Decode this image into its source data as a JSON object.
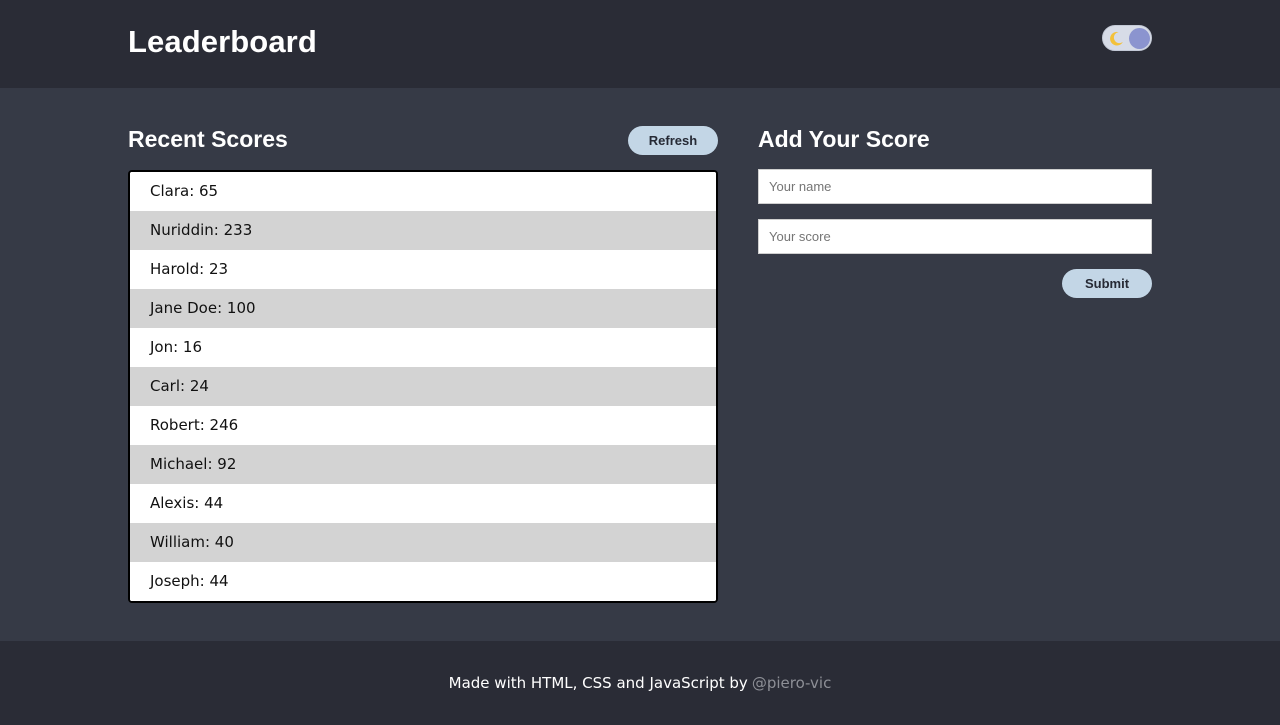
{
  "header": {
    "title": "Leaderboard",
    "theme_toggle": {
      "icon": "moon-icon",
      "state": "dark"
    }
  },
  "recent": {
    "title": "Recent Scores",
    "refresh_label": "Refresh",
    "scores": [
      "Clara: 65",
      "Nuriddin: 233",
      "Harold: 23",
      "Jane Doe: 100",
      "Jon: 16",
      "Carl: 24",
      "Robert: 246",
      "Michael: 92",
      "Alexis: 44",
      "William: 40",
      "Joseph: 44"
    ]
  },
  "add": {
    "title": "Add Your Score",
    "name_placeholder": "Your name",
    "score_placeholder": "Your score",
    "submit_label": "Submit"
  },
  "footer": {
    "text": "Made with HTML, CSS and JavaScript by",
    "link": "@piero-vic"
  },
  "colors": {
    "header_bg": "#2a2c36",
    "main_bg": "#363a46",
    "button_bg": "#c3d6e6",
    "alt_row": "#d3d3d3",
    "moon": "#f3c13a",
    "knob": "#8b94cf"
  }
}
